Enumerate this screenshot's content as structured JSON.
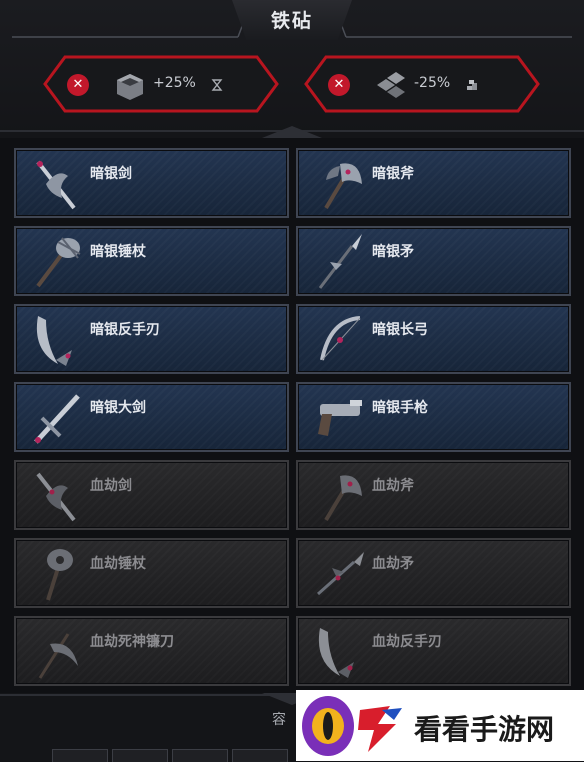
{
  "header": {
    "title": "铁砧"
  },
  "modifiers": [
    {
      "icon": "crate-icon",
      "value": "+25%",
      "unit_icon": "hourglass-icon"
    },
    {
      "icon": "tiles-icon",
      "value": "-25%",
      "unit_icon": "coins-icon"
    }
  ],
  "weapons": [
    {
      "name": "暗银剑",
      "icon": "sword-icon",
      "tier": "silver"
    },
    {
      "name": "暗银斧",
      "icon": "axe-icon",
      "tier": "silver"
    },
    {
      "name": "暗银锤杖",
      "icon": "mace-icon",
      "tier": "silver"
    },
    {
      "name": "暗银矛",
      "icon": "spear-icon",
      "tier": "silver"
    },
    {
      "name": "暗银反手刃",
      "icon": "reverse-blade-icon",
      "tier": "silver"
    },
    {
      "name": "暗银长弓",
      "icon": "longbow-icon",
      "tier": "silver"
    },
    {
      "name": "暗银大剑",
      "icon": "greatsword-icon",
      "tier": "silver"
    },
    {
      "name": "暗银手枪",
      "icon": "pistol-icon",
      "tier": "silver"
    },
    {
      "name": "血劫剑",
      "icon": "sword-icon",
      "tier": "blood"
    },
    {
      "name": "血劫斧",
      "icon": "axe-icon",
      "tier": "blood"
    },
    {
      "name": "血劫锤杖",
      "icon": "mace-icon",
      "tier": "blood"
    },
    {
      "name": "血劫矛",
      "icon": "spear-icon",
      "tier": "blood"
    },
    {
      "name": "血劫死神镰刀",
      "icon": "scythe-icon",
      "tier": "blood"
    },
    {
      "name": "血劫反手刃",
      "icon": "reverse-blade-icon",
      "tier": "blood"
    }
  ],
  "footer": {
    "capacity_label": "容"
  },
  "watermark": {
    "text": "看看手游网"
  },
  "colors": {
    "accent_red": "#c2182b",
    "silver_card": "#1d2d45",
    "blood_card": "#252527"
  }
}
